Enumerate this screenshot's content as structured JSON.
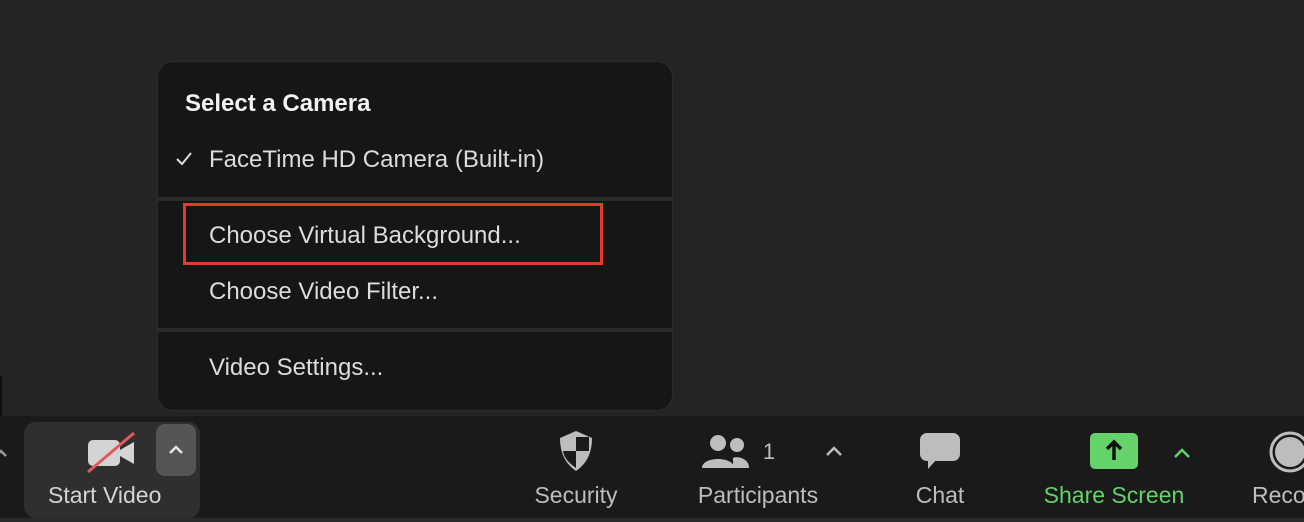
{
  "camera_menu": {
    "title": "Select a Camera",
    "cameras": [
      {
        "label": "FaceTime HD Camera (Built-in)",
        "selected": true
      }
    ],
    "items": [
      {
        "label": "Choose Virtual Background...",
        "highlighted": true
      },
      {
        "label": "Choose Video Filter..."
      }
    ],
    "settings_label": "Video Settings..."
  },
  "toolbar": {
    "start_video": "Start Video",
    "security": "Security",
    "participants": "Participants",
    "participant_count": "1",
    "chat": "Chat",
    "share_screen": "Share Screen",
    "record": "Reco"
  },
  "colors": {
    "highlight": "#e33b2a",
    "share_green": "#63d36a",
    "video_off_slash": "#e05a5a"
  }
}
